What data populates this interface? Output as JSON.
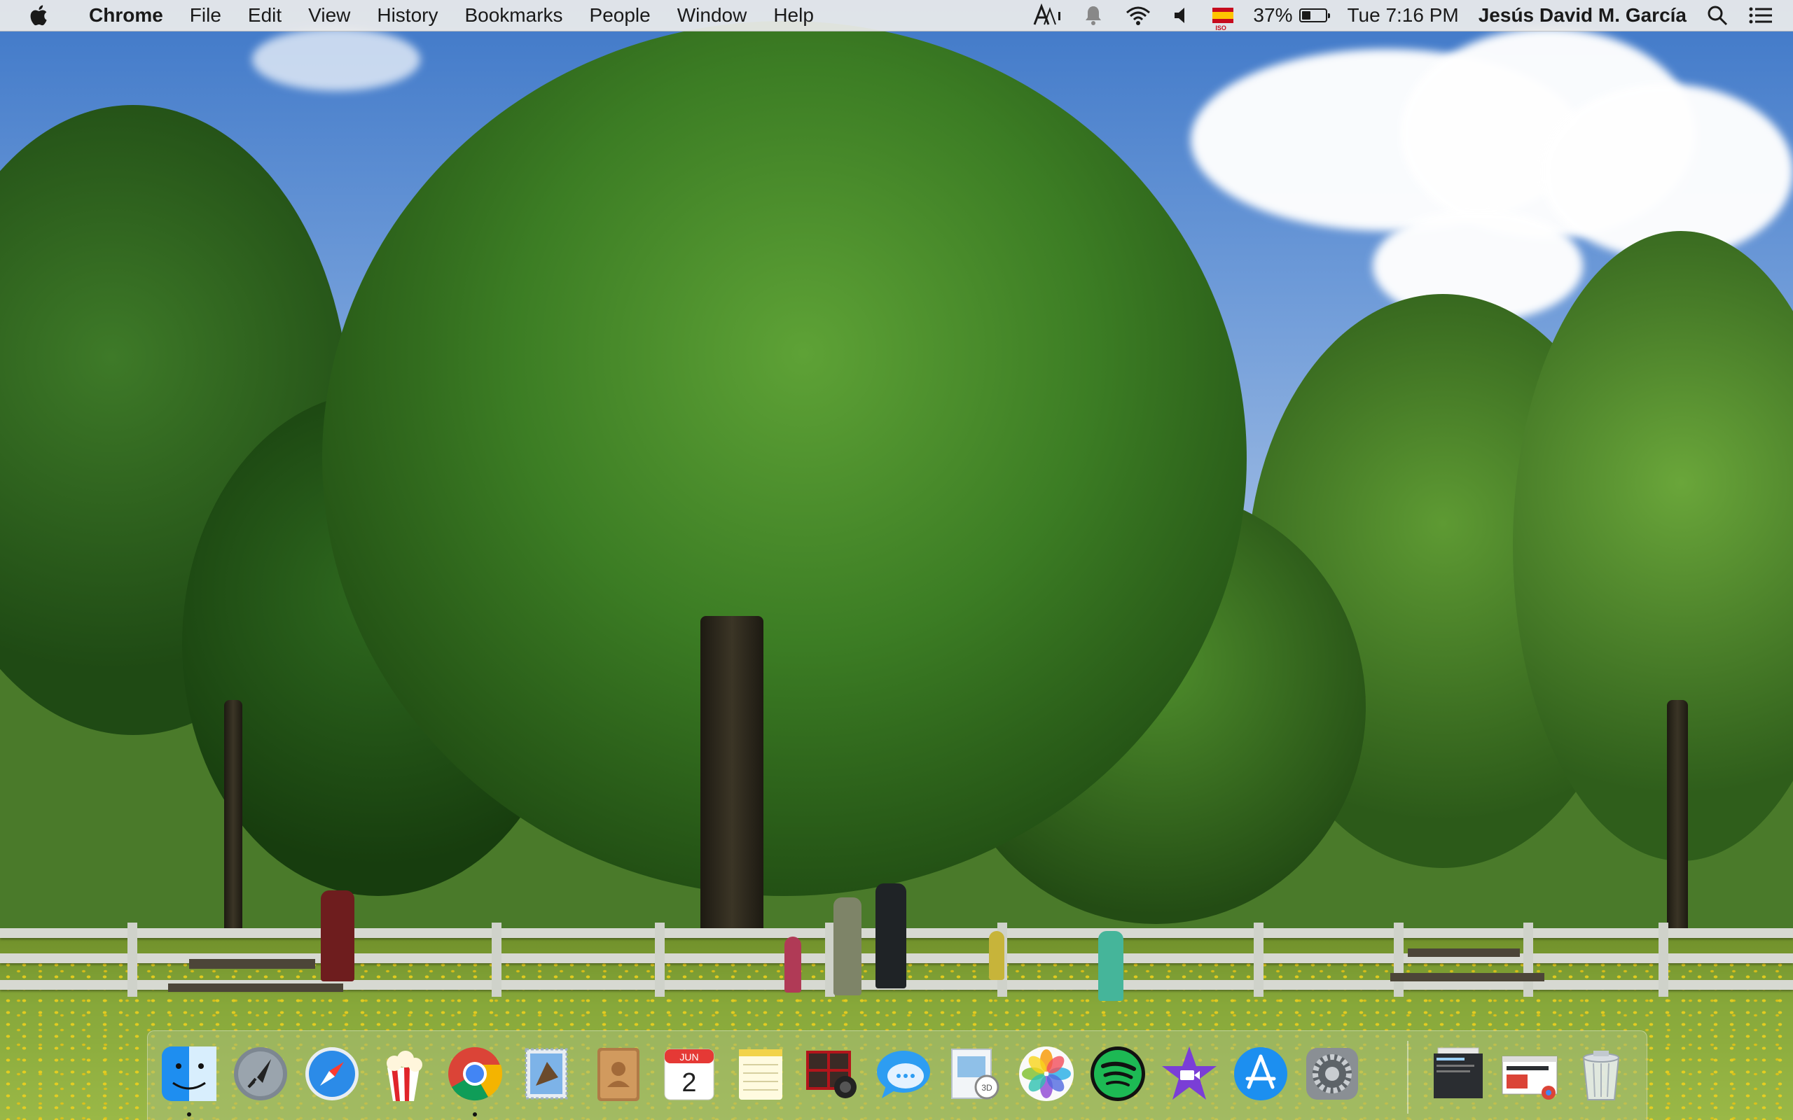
{
  "menubar": {
    "app_name": "Chrome",
    "menus": [
      "File",
      "Edit",
      "View",
      "History",
      "Bookmarks",
      "People",
      "Window",
      "Help"
    ],
    "status": {
      "battery_percent_label": "37%",
      "battery_level": 0.37,
      "clock": "Tue 7:16 PM",
      "user_name": "Jesús David M. García"
    }
  },
  "dock": {
    "apps": [
      {
        "name": "Finder",
        "icon": "finder-icon",
        "running": true
      },
      {
        "name": "Launchpad",
        "icon": "rocket-icon",
        "running": false
      },
      {
        "name": "Safari",
        "icon": "compass-icon",
        "running": false
      },
      {
        "name": "Popcorn Time",
        "icon": "popcorn-icon",
        "running": false
      },
      {
        "name": "Google Chrome",
        "icon": "chrome-icon",
        "running": true
      },
      {
        "name": "Mail",
        "icon": "stamp-icon",
        "running": false
      },
      {
        "name": "Contacts",
        "icon": "address-book-icon",
        "running": false
      },
      {
        "name": "Calendar",
        "icon": "calendar-icon",
        "running": false,
        "month": "JUN",
        "day": "2"
      },
      {
        "name": "Notes",
        "icon": "notepad-icon",
        "running": false
      },
      {
        "name": "Photo Booth",
        "icon": "photo-booth-icon",
        "running": false
      },
      {
        "name": "Messages",
        "icon": "speech-bubble-icon",
        "running": false
      },
      {
        "name": "Preview",
        "icon": "preview-icon",
        "running": false
      },
      {
        "name": "Photos",
        "icon": "pinwheel-icon",
        "running": false
      },
      {
        "name": "Spotify",
        "icon": "spotify-icon",
        "running": false
      },
      {
        "name": "iMovie",
        "icon": "star-camera-icon",
        "running": false
      },
      {
        "name": "App Store",
        "icon": "app-store-icon",
        "running": false
      },
      {
        "name": "System Preferences",
        "icon": "gear-icon",
        "running": false
      }
    ],
    "stacks": [
      {
        "name": "Downloads",
        "icon": "document-stack-icon"
      },
      {
        "name": "Chrome window",
        "icon": "window-thumbnail-icon"
      },
      {
        "name": "Trash",
        "icon": "trash-icon"
      }
    ]
  },
  "colors": {
    "menubar_bg": "#ececec",
    "chrome_red": "#db4437",
    "chrome_green": "#0f9d58",
    "chrome_yellow": "#f4b400",
    "chrome_blue": "#4285f4",
    "spotify_green": "#1db954"
  }
}
